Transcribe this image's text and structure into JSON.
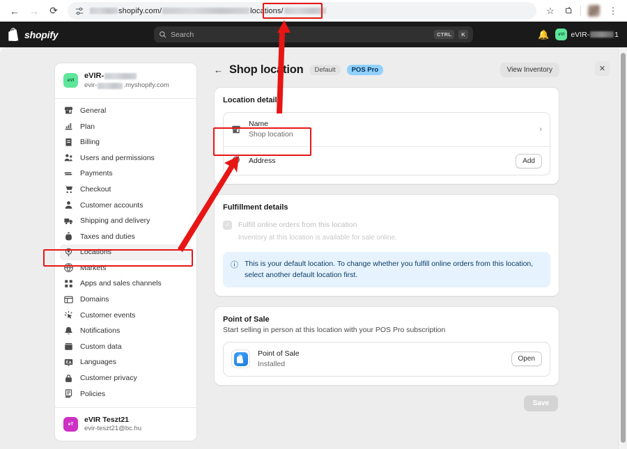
{
  "browser": {
    "back_icon": "back-arrow-icon",
    "forward_icon": "forward-arrow-icon",
    "reload_icon": "reload-icon",
    "site_settings_icon": "site-settings-icon",
    "url_visible_parts": [
      "shopify.com/",
      "locations",
      "/"
    ],
    "bookmark_icon": "star-icon",
    "extensions_icon": "extensions-icon",
    "menu_icon": "kebab-menu-icon"
  },
  "topbar": {
    "brand": "shopify",
    "search_placeholder": "Search",
    "kbd_ctrl": "CTRL",
    "kbd_k": "K",
    "notification_icon": "bell-icon",
    "store_avatar_initials": "eVI",
    "store_name_prefix": "eVIR-",
    "store_name_suffix": "1"
  },
  "modal": {
    "close_icon": "close-icon"
  },
  "sidebar": {
    "store": {
      "avatar_initials": "eVI",
      "name_prefix": "eVIR-",
      "domain_prefix": "evir-",
      "domain_suffix": ".myshopify.com"
    },
    "items": [
      {
        "label": "General",
        "icon": "store-icon"
      },
      {
        "label": "Plan",
        "icon": "chart-icon"
      },
      {
        "label": "Billing",
        "icon": "receipt-icon"
      },
      {
        "label": "Users and permissions",
        "icon": "users-icon"
      },
      {
        "label": "Payments",
        "icon": "payments-icon"
      },
      {
        "label": "Checkout",
        "icon": "cart-icon"
      },
      {
        "label": "Customer accounts",
        "icon": "person-icon"
      },
      {
        "label": "Shipping and delivery",
        "icon": "truck-icon"
      },
      {
        "label": "Taxes and duties",
        "icon": "tax-icon"
      },
      {
        "label": "Locations",
        "icon": "location-pin-icon"
      },
      {
        "label": "Markets",
        "icon": "globe-icon"
      },
      {
        "label": "Apps and sales channels",
        "icon": "apps-grid-icon"
      },
      {
        "label": "Domains",
        "icon": "domains-icon"
      },
      {
        "label": "Customer events",
        "icon": "events-icon"
      },
      {
        "label": "Notifications",
        "icon": "bell-icon"
      },
      {
        "label": "Custom data",
        "icon": "database-icon"
      },
      {
        "label": "Languages",
        "icon": "translate-icon"
      },
      {
        "label": "Customer privacy",
        "icon": "lock-icon"
      },
      {
        "label": "Policies",
        "icon": "policy-icon"
      }
    ],
    "active_item": "Locations",
    "user": {
      "avatar_initials": "eT",
      "name": "eVIR Teszt21",
      "email": "evir-teszt21@bc.hu"
    }
  },
  "main": {
    "back_icon": "back-arrow-icon",
    "title": "Shop location",
    "badge_default": "Default",
    "badge_pos_pro": "POS Pro",
    "view_inventory_label": "View Inventory",
    "location_details": {
      "title": "Location details",
      "name_row": {
        "icon": "store-icon",
        "label": "Name",
        "value": "Shop location",
        "chevron": "chevron-right-icon"
      },
      "address_row": {
        "icon": "location-pin-icon",
        "label": "Address",
        "action_label": "Add"
      }
    },
    "fulfillment": {
      "title": "Fulfillment details",
      "checkbox_label": "Fulfill online orders from this location",
      "checkbox_help": "Inventory at this location is available for sale online.",
      "checkbox_checked": true,
      "banner_icon": "info-icon",
      "banner_text": "This is your default location. To change whether you fulfill online orders from this location, select another default location first."
    },
    "point_of_sale": {
      "title": "Point of Sale",
      "subtitle": "Start selling in person at this location with your POS Pro subscription",
      "app_icon": "shopify-pos-icon",
      "app_name": "Point of Sale",
      "app_status": "Installed",
      "open_label": "Open"
    },
    "save_label": "Save"
  },
  "annotations": {
    "color": "#e81515",
    "boxes": [
      "url-tail-box",
      "name-row-box",
      "locations-nav-box"
    ],
    "arrows": [
      "name-row-to-url-arrow",
      "locations-to-name-row-arrow"
    ]
  }
}
